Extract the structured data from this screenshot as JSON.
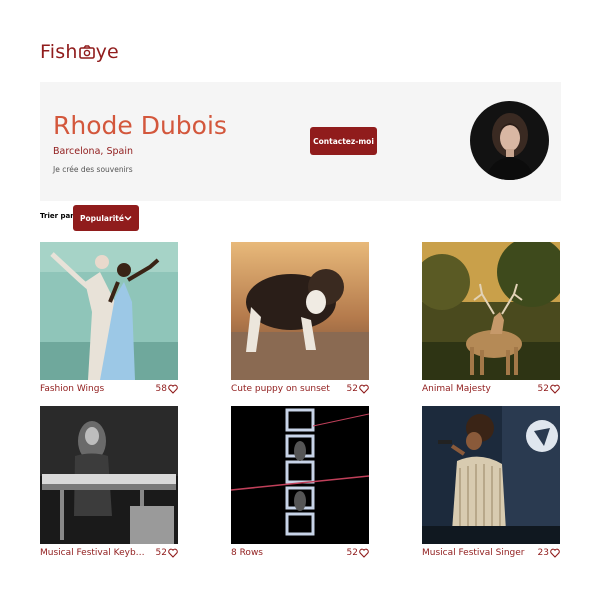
{
  "header": {
    "logo_left": "Fish",
    "logo_right": "ye"
  },
  "profile": {
    "name": "Rhode Dubois",
    "location": "Barcelona, Spain",
    "tagline": "Je crée des souvenirs",
    "contact_label": "Contactez-moi"
  },
  "sort": {
    "label": "Trier par",
    "selected": "Popularité"
  },
  "media": [
    {
      "title": "Fashion Wings",
      "likes": "58"
    },
    {
      "title": "Cute puppy on sunset",
      "likes": "52"
    },
    {
      "title": "Animal Majesty",
      "likes": "52"
    },
    {
      "title": "Musical Festival Keyboa...",
      "likes": "52"
    },
    {
      "title": "8 Rows",
      "likes": "52"
    },
    {
      "title": "Musical Festival Singer",
      "likes": "23"
    }
  ],
  "colors": {
    "brand": "#901c1c",
    "accent": "#d3573c",
    "panel": "#f5f5f5"
  }
}
